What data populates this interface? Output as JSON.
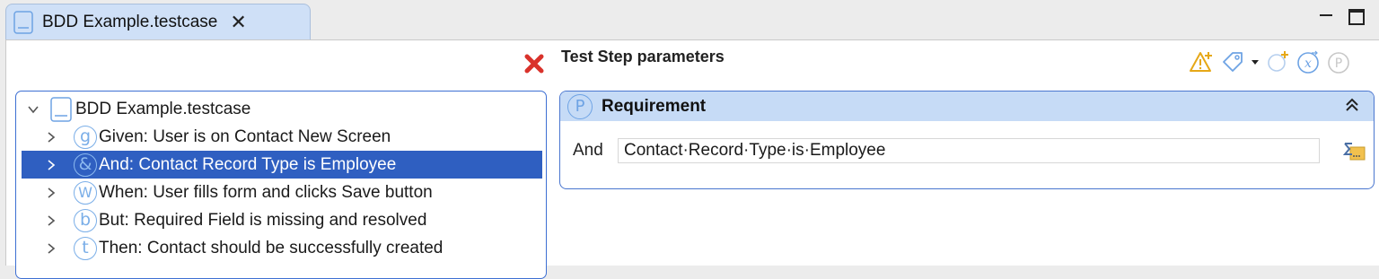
{
  "tab": {
    "title": "BDD Example.testcase",
    "close_glyph": "✕"
  },
  "params_title": "Test Step parameters",
  "tree": {
    "root": {
      "label": "BDD Example.testcase"
    },
    "items": [
      {
        "glyph": "g",
        "label": "Given: User is on Contact New Screen",
        "selected": false
      },
      {
        "glyph": "&",
        "label": "And: Contact Record Type is Employee",
        "selected": true
      },
      {
        "glyph": "W",
        "label": "When: User fills form and clicks Save button",
        "selected": false
      },
      {
        "glyph": "b",
        "label": "But: Required Field is missing and resolved",
        "selected": false
      },
      {
        "glyph": "t",
        "label": "Then: Contact should be successfully created",
        "selected": false
      }
    ]
  },
  "section": {
    "glyph": "P",
    "title": "Requirement",
    "collapse_glyph": "⌃",
    "field_label": "And",
    "field_value": "Contact·Record·Type·is·Employee"
  },
  "toolbar_icons": [
    "warning-add-icon",
    "tag-icon",
    "dropdown-arrow-icon",
    "add-step-icon",
    "variable-icon",
    "parameter-icon"
  ],
  "colors": {
    "selection": "#2f5fc1",
    "accent": "#3d6fd3",
    "section_header": "#c6dbf6"
  }
}
